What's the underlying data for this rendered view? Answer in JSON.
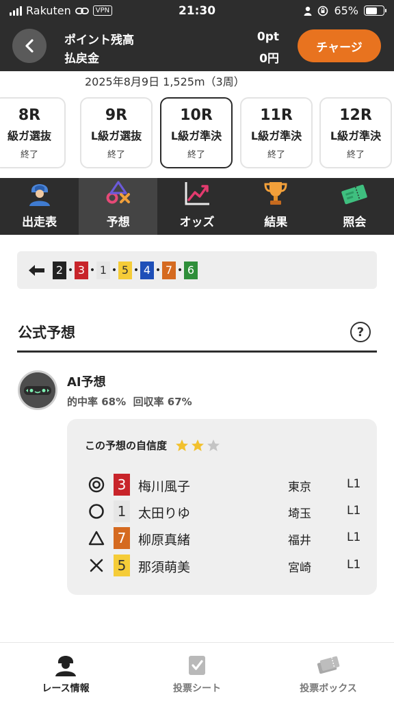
{
  "status_bar": {
    "carrier": "Rakuten",
    "vpn": "VPN",
    "time": "21:30",
    "battery": "65%"
  },
  "header": {
    "point_label": "ポイント残高",
    "point_value": "0pt",
    "refund_label": "払戻金",
    "refund_value": "0円",
    "charge_button": "チャージ"
  },
  "race_info": "2025年8月9日 1,525m（3周）",
  "races": [
    {
      "num": "8R",
      "title": "級ガ選抜",
      "status": "終了"
    },
    {
      "num": "9R",
      "title": "L級ガ選抜",
      "status": "終了"
    },
    {
      "num": "10R",
      "title": "L級ガ準決",
      "status": "終了"
    },
    {
      "num": "11R",
      "title": "L級ガ準決",
      "status": "終了"
    },
    {
      "num": "12R",
      "title": "L級ガ準決",
      "status": "終了"
    }
  ],
  "menu": [
    {
      "label": "出走表",
      "icon": "racer-icon"
    },
    {
      "label": "予想",
      "icon": "prediction-icon"
    },
    {
      "label": "オッズ",
      "icon": "odds-chart-icon"
    },
    {
      "label": "結果",
      "icon": "trophy-icon"
    },
    {
      "label": "照会",
      "icon": "ticket-icon"
    }
  ],
  "result_order": [
    {
      "num": "2",
      "bg": "#222222",
      "fg": "#ffffff"
    },
    {
      "num": "3",
      "bg": "#c8242a",
      "fg": "#ffffff"
    },
    {
      "num": "1",
      "bg": "#e6e6e6",
      "fg": "#333333"
    },
    {
      "num": "5",
      "bg": "#f5cc38",
      "fg": "#333333"
    },
    {
      "num": "4",
      "bg": "#1e4fb8",
      "fg": "#ffffff"
    },
    {
      "num": "7",
      "bg": "#d56a20",
      "fg": "#ffffff"
    },
    {
      "num": "6",
      "bg": "#2f8f3a",
      "fg": "#ffffff"
    }
  ],
  "section": {
    "title": "公式予想",
    "help": "?"
  },
  "ai": {
    "title": "AI予想",
    "rates": "的中率 68%  回収率 67%",
    "confidence_label": "この予想の自信度",
    "confidence_stars": 2,
    "confidence_max": 3
  },
  "predictions": [
    {
      "mark": "double-circle",
      "num": "3",
      "bg": "#c8242a",
      "fg": "#ffffff",
      "name": "梅川風子",
      "pref": "東京",
      "class": "L1"
    },
    {
      "mark": "circle",
      "num": "1",
      "bg": "#e6e6e6",
      "fg": "#333333",
      "name": "太田りゆ",
      "pref": "埼玉",
      "class": "L1"
    },
    {
      "mark": "triangle",
      "num": "7",
      "bg": "#d56a20",
      "fg": "#ffffff",
      "name": "柳原真緒",
      "pref": "福井",
      "class": "L1"
    },
    {
      "mark": "cross",
      "num": "5",
      "bg": "#f5cc38",
      "fg": "#333333",
      "name": "那須萌美",
      "pref": "宮崎",
      "class": "L1"
    }
  ],
  "bottom_nav": [
    {
      "label": "レース情報",
      "icon": "race-info-icon",
      "active": true
    },
    {
      "label": "投票シート",
      "icon": "vote-sheet-icon",
      "active": false
    },
    {
      "label": "投票ボックス",
      "icon": "vote-box-icon",
      "active": false
    }
  ],
  "colors": {
    "dark": "#2d2d2d",
    "accent": "#e8731f",
    "star_on": "#f2c12e",
    "star_off": "#c4c4c4"
  }
}
